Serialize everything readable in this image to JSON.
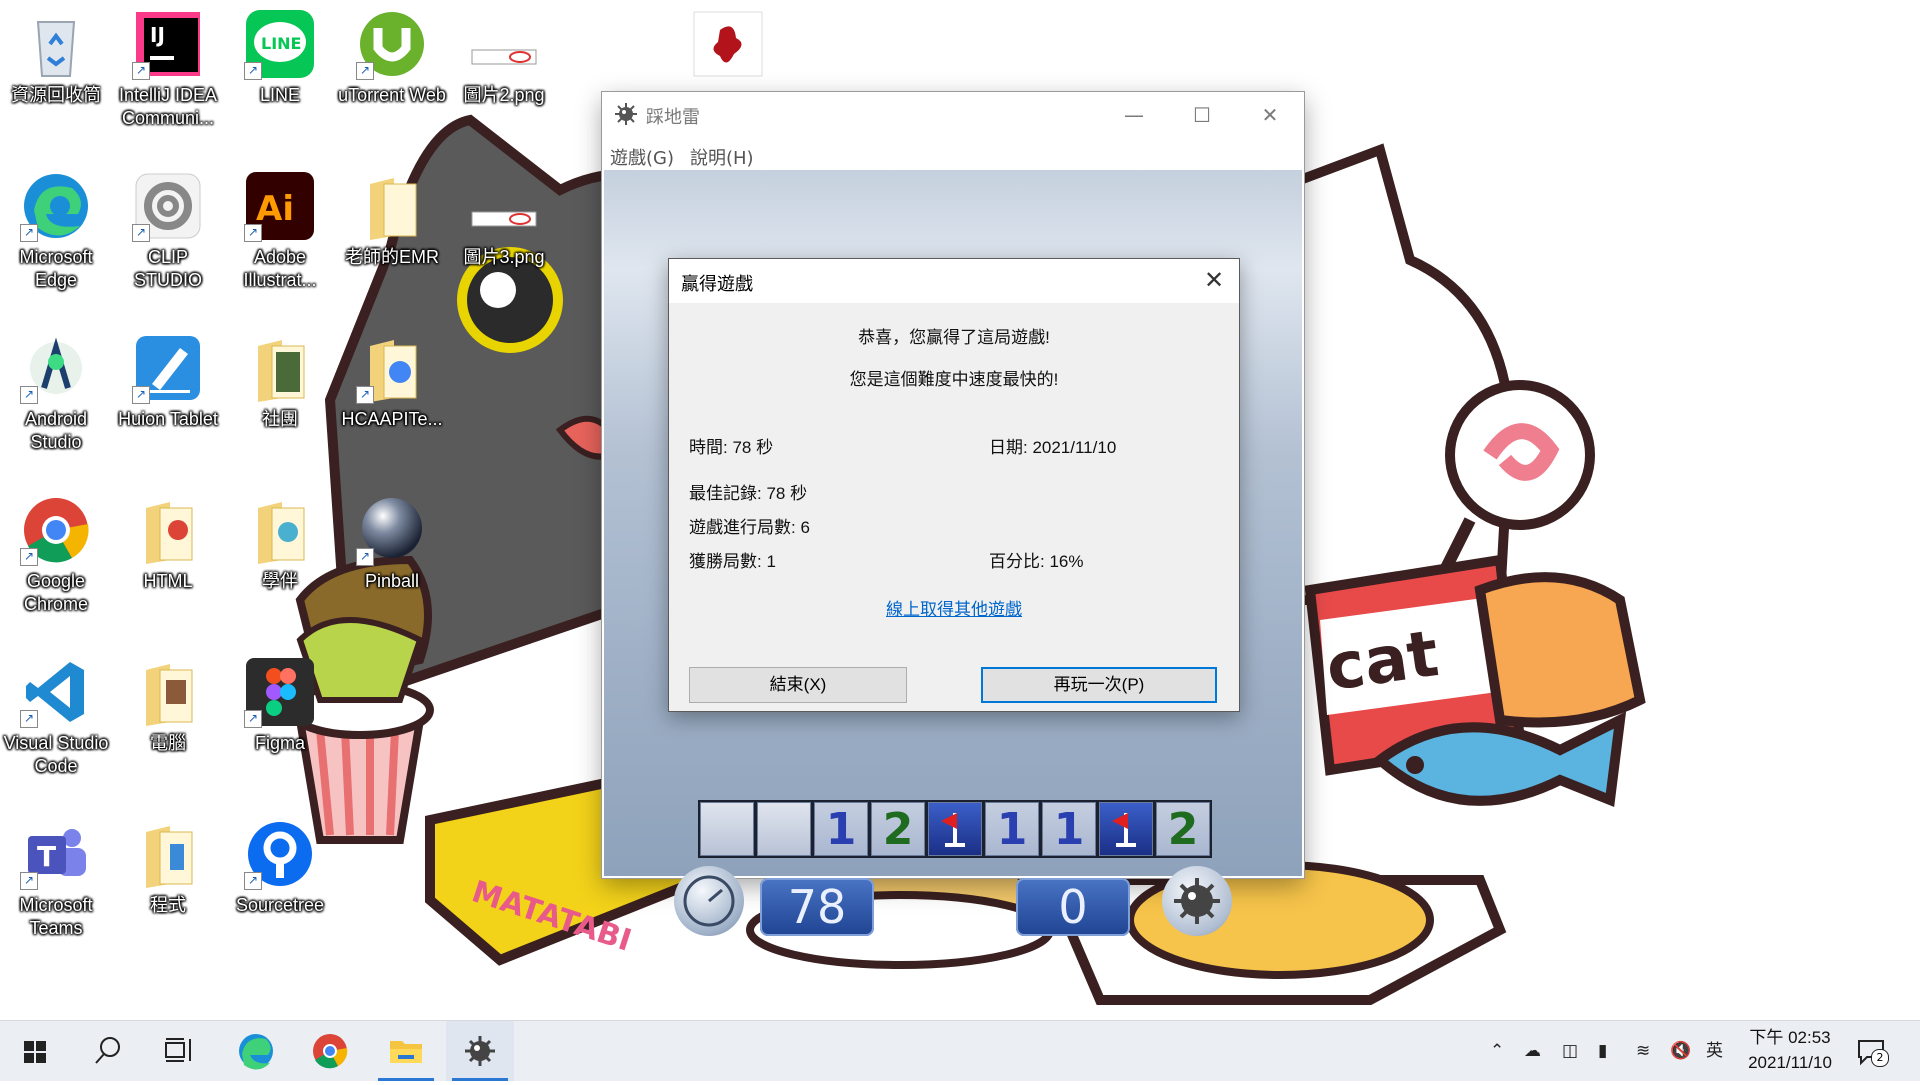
{
  "desktop": {
    "icons": [
      {
        "label": "資源回收筒"
      },
      {
        "label": "IntelliJ IDEA Communi..."
      },
      {
        "label": "LINE"
      },
      {
        "label": "uTorrent Web"
      },
      {
        "label": "圖片2.png"
      },
      {
        "label": "Microsoft Edge"
      },
      {
        "label": "CLIP STUDIO"
      },
      {
        "label": "Adobe Illustrat..."
      },
      {
        "label": "老師的EMR"
      },
      {
        "label": "圖片3.png"
      },
      {
        "label": "Android Studio"
      },
      {
        "label": "Huion Tablet"
      },
      {
        "label": "社團"
      },
      {
        "label": "HCAAPITe..."
      },
      {
        "label": "Google Chrome"
      },
      {
        "label": "HTML"
      },
      {
        "label": "學伴"
      },
      {
        "label": "Pinball"
      },
      {
        "label": "Visual Studio Code"
      },
      {
        "label": "電腦"
      },
      {
        "label": "Figma"
      },
      {
        "label": "Microsoft Teams"
      },
      {
        "label": "程式"
      },
      {
        "label": "Sourcetree"
      }
    ]
  },
  "window": {
    "title": "踩地雷",
    "menu": {
      "game": "遊戲(G)",
      "help": "說明(H)"
    },
    "timer": "78",
    "mines_left": "0",
    "visible_row": [
      "",
      "",
      "1",
      "2",
      "flag",
      "1",
      "1",
      "flag",
      "2"
    ]
  },
  "dialog": {
    "title": "贏得遊戲",
    "congrats": "恭喜，您贏得了這局遊戲!",
    "fastest": "您是這個難度中速度最快的!",
    "time": "時間: 78 秒",
    "date": "日期: 2021/11/10",
    "best": "最佳記錄: 78 秒",
    "played": "遊戲進行局數: 6",
    "won": "獲勝局數: 1",
    "percent": "百分比: 16%",
    "link": "線上取得其他遊戲",
    "exit_button": "結束(X)",
    "play_again_button": "再玩一次(P)"
  },
  "taskbar": {
    "tray_language": "英",
    "clock_time": "下午 02:53",
    "clock_date": "2021/11/10",
    "notification_count": "2",
    "accent": "#2a78d4"
  },
  "colors": {
    "wallpaper": "#ffffff",
    "dialog_bg": "#f0f0f0",
    "link": "#0066cc",
    "default_button_border": "#0078d7"
  }
}
